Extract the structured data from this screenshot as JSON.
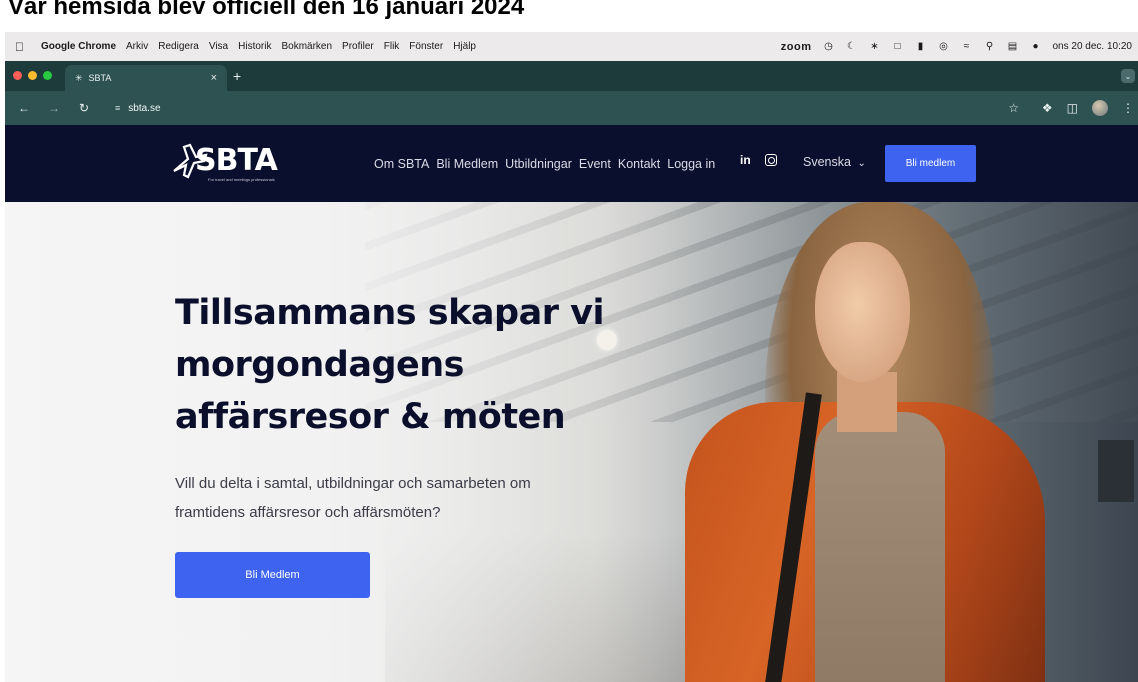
{
  "caption": "Vår hemsida blev officiell den 16 januari 2024",
  "menubar": {
    "app": "Google Chrome",
    "items": [
      "Arkiv",
      "Redigera",
      "Visa",
      "Historik",
      "Bokmärken",
      "Profiler",
      "Flik",
      "Fönster",
      "Hjälp"
    ],
    "zoom": "zoom",
    "clock": "ons 20 dec. 10:20"
  },
  "browser": {
    "tab_title": "SBTA",
    "url": "sbta.se"
  },
  "site": {
    "logo_text": "SBTA",
    "logo_tagline": "For travel and meetings professionals",
    "nav": [
      "Om SBTA",
      "Bli Medlem",
      "Utbildningar",
      "Event",
      "Kontakt",
      "Logga in"
    ],
    "linkedin": "in",
    "language": "Svenska",
    "header_cta": "Bli medlem"
  },
  "hero": {
    "title_lines": [
      "Tillsammans skapar vi",
      "morgondagens",
      "affärsresor & möten"
    ],
    "subtitle_lines": [
      "Vill du delta i samtal, utbildningar och samarbeten om",
      "framtidens affärsresor och affärsmöten?"
    ],
    "cta": "Bli Medlem"
  },
  "colors": {
    "header_bg": "#0b0f2e",
    "accent": "#3d63f0",
    "chrome_bg": "#2e5152"
  }
}
